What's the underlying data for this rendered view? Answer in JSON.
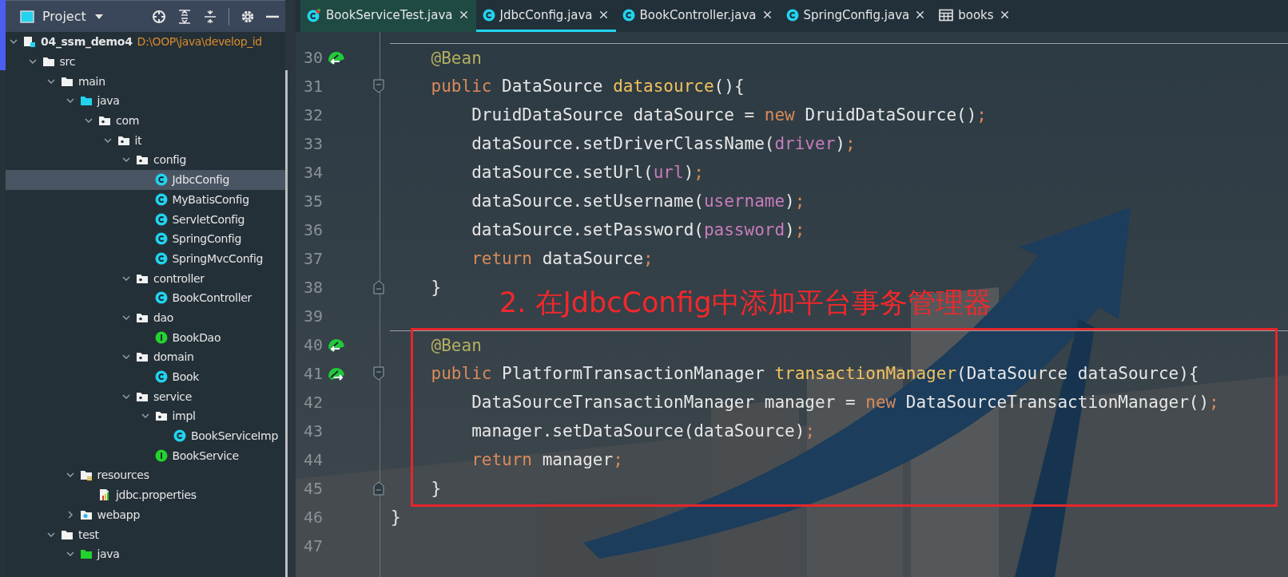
{
  "project_panel": {
    "title": "Project",
    "tree": [
      {
        "label": "04_ssm_demo4",
        "path": "D:\\OOP\\java\\develop_id",
        "kind": "module",
        "expanded": true,
        "selected": false,
        "children": [
          {
            "label": "src",
            "kind": "folder",
            "expanded": true,
            "selected": false,
            "children": [
              {
                "label": "main",
                "kind": "folder",
                "expanded": true,
                "selected": false,
                "children": [
                  {
                    "label": "java",
                    "kind": "source-root",
                    "expanded": true,
                    "selected": false,
                    "children": [
                      {
                        "label": "com",
                        "kind": "package",
                        "expanded": true,
                        "selected": false,
                        "children": [
                          {
                            "label": "it",
                            "kind": "package",
                            "expanded": true,
                            "selected": false,
                            "children": [
                              {
                                "label": "config",
                                "kind": "package",
                                "expanded": true,
                                "selected": false,
                                "children": [
                                  {
                                    "label": "JdbcConfig",
                                    "kind": "class",
                                    "selected": true
                                  },
                                  {
                                    "label": "MyBatisConfig",
                                    "kind": "class",
                                    "selected": false
                                  },
                                  {
                                    "label": "ServletConfig",
                                    "kind": "class",
                                    "selected": false
                                  },
                                  {
                                    "label": "SpringConfig",
                                    "kind": "class",
                                    "selected": false
                                  },
                                  {
                                    "label": "SpringMvcConfig",
                                    "kind": "class",
                                    "selected": false
                                  }
                                ]
                              },
                              {
                                "label": "controller",
                                "kind": "package",
                                "expanded": true,
                                "selected": false,
                                "children": [
                                  {
                                    "label": "BookController",
                                    "kind": "class",
                                    "selected": false
                                  }
                                ]
                              },
                              {
                                "label": "dao",
                                "kind": "package",
                                "expanded": true,
                                "selected": false,
                                "children": [
                                  {
                                    "label": "BookDao",
                                    "kind": "interface",
                                    "selected": false
                                  }
                                ]
                              },
                              {
                                "label": "domain",
                                "kind": "package",
                                "expanded": true,
                                "selected": false,
                                "children": [
                                  {
                                    "label": "Book",
                                    "kind": "class",
                                    "selected": false
                                  }
                                ]
                              },
                              {
                                "label": "service",
                                "kind": "package",
                                "expanded": true,
                                "selected": false,
                                "children": [
                                  {
                                    "label": "impl",
                                    "kind": "package",
                                    "expanded": true,
                                    "selected": false,
                                    "children": [
                                      {
                                        "label": "BookServiceImp",
                                        "kind": "class",
                                        "selected": false
                                      }
                                    ]
                                  },
                                  {
                                    "label": "BookService",
                                    "kind": "interface",
                                    "selected": false
                                  }
                                ]
                              }
                            ]
                          }
                        ]
                      }
                    ]
                  },
                  {
                    "label": "resources",
                    "kind": "resources-root",
                    "expanded": true,
                    "selected": false,
                    "children": [
                      {
                        "label": "jdbc.properties",
                        "kind": "properties",
                        "selected": false
                      }
                    ]
                  },
                  {
                    "label": "webapp",
                    "kind": "web-folder",
                    "expanded": false,
                    "selected": false
                  }
                ]
              },
              {
                "label": "test",
                "kind": "folder",
                "expanded": true,
                "selected": false,
                "children": [
                  {
                    "label": "java",
                    "kind": "test-root",
                    "expanded": true,
                    "selected": false
                  }
                ]
              }
            ]
          }
        ]
      }
    ]
  },
  "tabs": [
    {
      "label": "BookServiceTest.java",
      "kind": "test-class",
      "selected": false
    },
    {
      "label": "JdbcConfig.java",
      "kind": "class",
      "selected": true
    },
    {
      "label": "BookController.java",
      "kind": "class",
      "selected": false
    },
    {
      "label": "SpringConfig.java",
      "kind": "class",
      "selected": false
    },
    {
      "label": "books",
      "kind": "table",
      "selected": false
    }
  ],
  "editor": {
    "lines": [
      {
        "number": "30",
        "kind": "member",
        "separator": true,
        "bean_in": true,
        "bean_out": false,
        "fold_open": false,
        "fold_close": false,
        "tokens": [
          {
            "kind": "annotation",
            "text": "@Bean"
          }
        ]
      },
      {
        "number": "31",
        "kind": "member",
        "separator": false,
        "bean_in": false,
        "bean_out": false,
        "fold_open": true,
        "fold_close": false,
        "tokens": [
          {
            "kind": "keyword",
            "text": "public "
          },
          {
            "kind": "plain",
            "text": "DataSource "
          },
          {
            "kind": "method",
            "text": "datasource"
          },
          {
            "kind": "plain",
            "text": "(){"
          }
        ]
      },
      {
        "number": "32",
        "kind": "body",
        "separator": false,
        "bean_in": false,
        "bean_out": false,
        "fold_open": false,
        "fold_close": false,
        "tokens": [
          {
            "kind": "plain",
            "text": "DruidDataSource dataSource = "
          },
          {
            "kind": "keyword",
            "text": "new "
          },
          {
            "kind": "plain",
            "text": "DruidDataSource()"
          },
          {
            "kind": "keyword",
            "text": ";"
          }
        ]
      },
      {
        "number": "33",
        "kind": "body",
        "separator": false,
        "bean_in": false,
        "bean_out": false,
        "fold_open": false,
        "fold_close": false,
        "tokens": [
          {
            "kind": "plain",
            "text": "dataSource.setDriverClassName("
          },
          {
            "kind": "field",
            "text": "driver"
          },
          {
            "kind": "plain",
            "text": ")"
          },
          {
            "kind": "keyword",
            "text": ";"
          }
        ]
      },
      {
        "number": "34",
        "kind": "body",
        "separator": false,
        "bean_in": false,
        "bean_out": false,
        "fold_open": false,
        "fold_close": false,
        "tokens": [
          {
            "kind": "plain",
            "text": "dataSource.setUrl("
          },
          {
            "kind": "field",
            "text": "url"
          },
          {
            "kind": "plain",
            "text": ")"
          },
          {
            "kind": "keyword",
            "text": ";"
          }
        ]
      },
      {
        "number": "35",
        "kind": "body",
        "separator": false,
        "bean_in": false,
        "bean_out": false,
        "fold_open": false,
        "fold_close": false,
        "tokens": [
          {
            "kind": "plain",
            "text": "dataSource.setUsername("
          },
          {
            "kind": "field",
            "text": "username"
          },
          {
            "kind": "plain",
            "text": ")"
          },
          {
            "kind": "keyword",
            "text": ";"
          }
        ]
      },
      {
        "number": "36",
        "kind": "body",
        "separator": false,
        "bean_in": false,
        "bean_out": false,
        "fold_open": false,
        "fold_close": false,
        "tokens": [
          {
            "kind": "plain",
            "text": "dataSource.setPassword("
          },
          {
            "kind": "field",
            "text": "password"
          },
          {
            "kind": "plain",
            "text": ")"
          },
          {
            "kind": "keyword",
            "text": ";"
          }
        ]
      },
      {
        "number": "37",
        "kind": "body",
        "separator": false,
        "bean_in": false,
        "bean_out": false,
        "fold_open": false,
        "fold_close": false,
        "tokens": [
          {
            "kind": "keyword",
            "text": "return "
          },
          {
            "kind": "plain",
            "text": "dataSource"
          },
          {
            "kind": "keyword",
            "text": ";"
          }
        ]
      },
      {
        "number": "38",
        "kind": "member",
        "separator": false,
        "bean_in": false,
        "bean_out": false,
        "fold_open": false,
        "fold_close": true,
        "tokens": [
          {
            "kind": "plain",
            "text": "}"
          }
        ]
      },
      {
        "number": "39",
        "kind": "member",
        "separator": false,
        "bean_in": false,
        "bean_out": false,
        "fold_open": false,
        "fold_close": false
      },
      {
        "number": "40",
        "kind": "member",
        "separator": true,
        "bean_in": true,
        "bean_out": false,
        "fold_open": false,
        "fold_close": false,
        "tokens": [
          {
            "kind": "annotation",
            "text": "@Bean"
          }
        ]
      },
      {
        "number": "41",
        "kind": "member",
        "separator": false,
        "bean_in": false,
        "bean_out": true,
        "fold_open": true,
        "fold_close": false,
        "tokens": [
          {
            "kind": "keyword",
            "text": "public "
          },
          {
            "kind": "plain",
            "text": "PlatformTransactionManager "
          },
          {
            "kind": "method",
            "text": "transactionManager"
          },
          {
            "kind": "plain",
            "text": "(DataSource dataSource){"
          }
        ]
      },
      {
        "number": "42",
        "kind": "body",
        "separator": false,
        "bean_in": false,
        "bean_out": false,
        "fold_open": false,
        "fold_close": false,
        "tokens": [
          {
            "kind": "plain",
            "text": "DataSourceTransactionManager manager = "
          },
          {
            "kind": "keyword",
            "text": "new "
          },
          {
            "kind": "plain",
            "text": "DataSourceTransactionManager()"
          },
          {
            "kind": "keyword",
            "text": ";"
          }
        ]
      },
      {
        "number": "43",
        "kind": "body",
        "separator": false,
        "bean_in": false,
        "bean_out": false,
        "fold_open": false,
        "fold_close": false,
        "tokens": [
          {
            "kind": "plain",
            "text": "manager.setDataSource(dataSource)"
          },
          {
            "kind": "keyword",
            "text": ";"
          }
        ]
      },
      {
        "number": "44",
        "kind": "body",
        "separator": false,
        "bean_in": false,
        "bean_out": false,
        "fold_open": false,
        "fold_close": false,
        "tokens": [
          {
            "kind": "keyword",
            "text": "return "
          },
          {
            "kind": "plain",
            "text": "manager"
          },
          {
            "kind": "keyword",
            "text": ";"
          }
        ]
      },
      {
        "number": "45",
        "kind": "member",
        "separator": false,
        "bean_in": false,
        "bean_out": false,
        "fold_open": false,
        "fold_close": true,
        "tokens": [
          {
            "kind": "plain",
            "text": "}"
          }
        ]
      },
      {
        "number": "46",
        "kind": "class",
        "separator": false,
        "bean_in": false,
        "bean_out": false,
        "fold_open": false,
        "fold_close": false,
        "tokens": [
          {
            "kind": "plain",
            "text": "}"
          }
        ]
      },
      {
        "number": "47",
        "kind": "member",
        "separator": false,
        "bean_in": false,
        "bean_out": false,
        "fold_open": false,
        "fold_close": false
      }
    ]
  },
  "annotation": {
    "text": "2. 在JdbcConfig中添加平台事务管理器"
  }
}
